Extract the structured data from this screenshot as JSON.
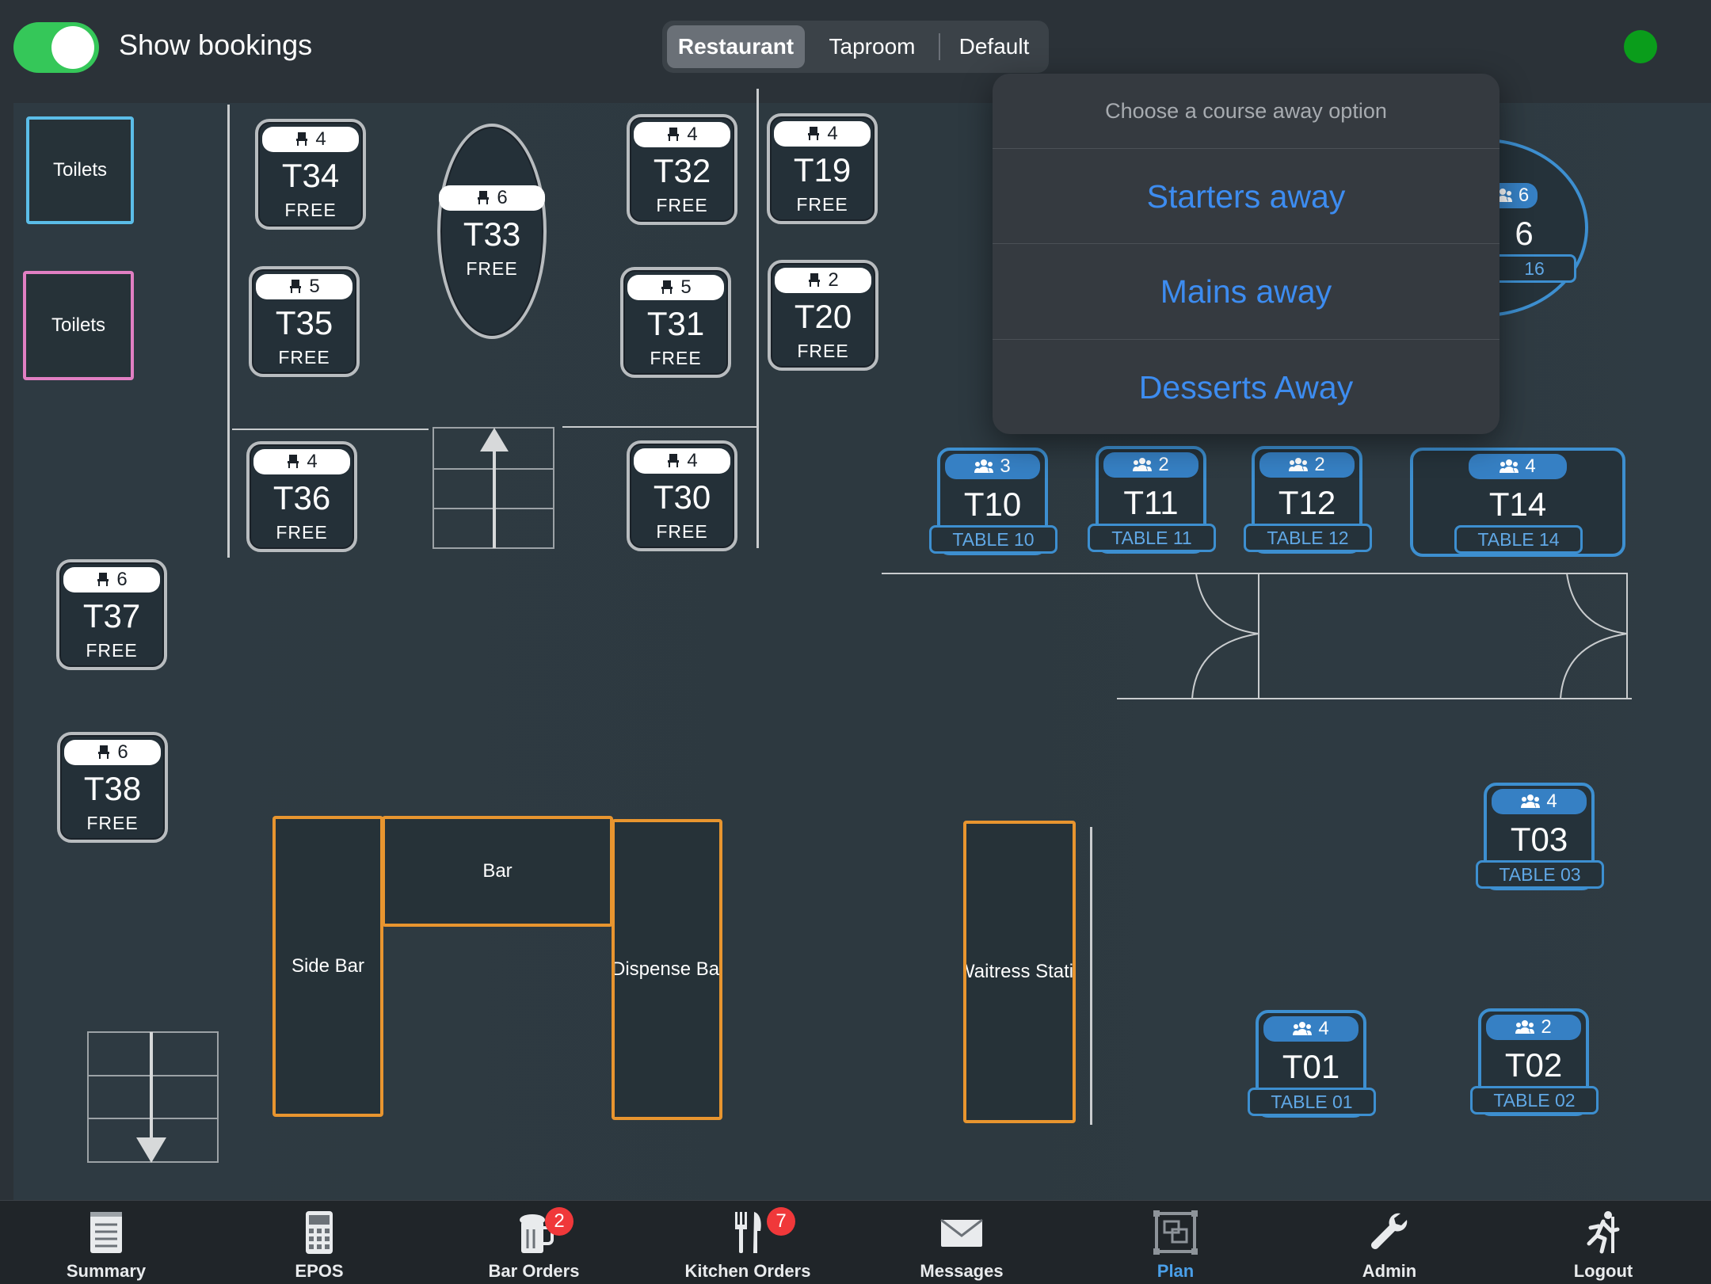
{
  "header": {
    "toggle_label": "Show bookings",
    "toggle_on": true,
    "segments": [
      {
        "label": "Restaurant",
        "active": true
      },
      {
        "label": "Taproom",
        "active": false
      },
      {
        "label": "Default",
        "active": false
      }
    ],
    "status_color": "#0a9d1b"
  },
  "rooms": {
    "toilets_blue": "Toilets",
    "toilets_pink": "Toilets",
    "bar": "Bar",
    "side_bar": "Side Bar",
    "dispense_bar": "Dispense Bar",
    "waitress_station": "Waitress Station"
  },
  "free_tables": {
    "t34": {
      "name": "T34",
      "seats": "4",
      "status": "FREE"
    },
    "t33": {
      "name": "T33",
      "seats": "6",
      "status": "FREE"
    },
    "t32": {
      "name": "T32",
      "seats": "4",
      "status": "FREE"
    },
    "t19": {
      "name": "T19",
      "seats": "4",
      "status": "FREE"
    },
    "t35": {
      "name": "T35",
      "seats": "5",
      "status": "FREE"
    },
    "t31": {
      "name": "T31",
      "seats": "5",
      "status": "FREE"
    },
    "t20": {
      "name": "T20",
      "seats": "2",
      "status": "FREE"
    },
    "t36": {
      "name": "T36",
      "seats": "4",
      "status": "FREE"
    },
    "t30": {
      "name": "T30",
      "seats": "4",
      "status": "FREE"
    },
    "t37": {
      "name": "T37",
      "seats": "6",
      "status": "FREE"
    },
    "t38": {
      "name": "T38",
      "seats": "6",
      "status": "FREE"
    }
  },
  "booked_tables": {
    "t10": {
      "name": "T10",
      "covers": "3",
      "label": "TABLE 10"
    },
    "t11": {
      "name": "T11",
      "covers": "2",
      "label": "TABLE 11"
    },
    "t12": {
      "name": "T12",
      "covers": "2",
      "label": "TABLE 12"
    },
    "t14": {
      "name": "T14",
      "covers": "4",
      "label": "TABLE 14"
    },
    "t16": {
      "name": "6",
      "covers": "6",
      "label": "16"
    },
    "t03": {
      "name": "T03",
      "covers": "4",
      "label": "TABLE 03"
    },
    "t01": {
      "name": "T01",
      "covers": "4",
      "label": "TABLE 01"
    },
    "t02": {
      "name": "T02",
      "covers": "2",
      "label": "TABLE 02"
    }
  },
  "popover": {
    "title": "Choose a course away option",
    "options": [
      "Starters away",
      "Mains away",
      "Desserts Away"
    ]
  },
  "tabbar": {
    "items": [
      {
        "label": "Summary",
        "icon": "notepad-icon"
      },
      {
        "label": "EPOS",
        "icon": "calculator-icon"
      },
      {
        "label": "Bar Orders",
        "icon": "beer-mug-icon",
        "badge": "2"
      },
      {
        "label": "Kitchen Orders",
        "icon": "cutlery-icon",
        "badge": "7"
      },
      {
        "label": "Messages",
        "icon": "envelope-icon"
      },
      {
        "label": "Plan",
        "icon": "floor-plan-icon",
        "active": true
      },
      {
        "label": "Admin",
        "icon": "wrench-icon"
      },
      {
        "label": "Logout",
        "icon": "running-person-icon"
      }
    ]
  },
  "colors": {
    "accent": "#3d8cf0",
    "booked_table": "#3d8fd0",
    "bar_zone": "#e8952f",
    "badge": "#f0383a"
  }
}
